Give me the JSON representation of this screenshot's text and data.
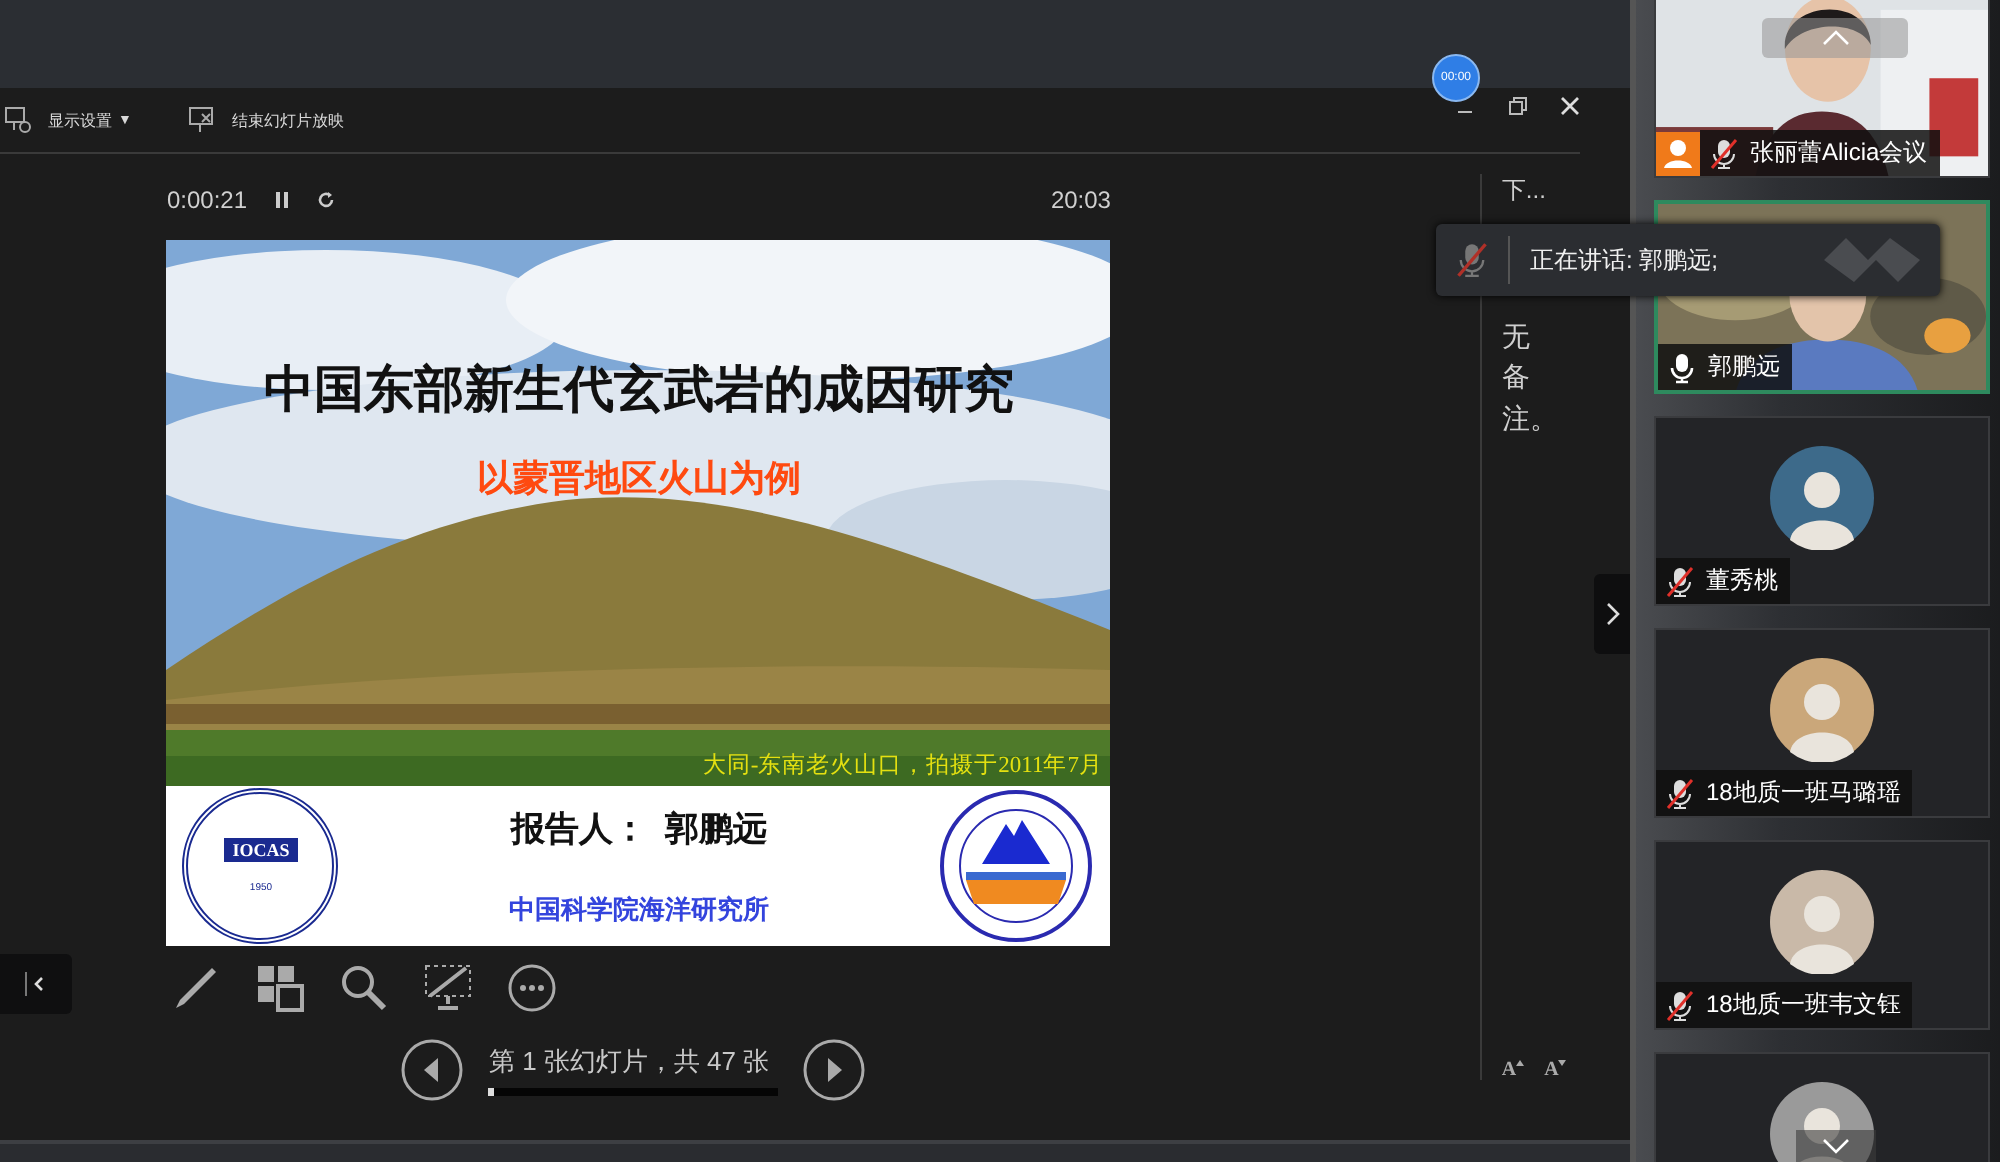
{
  "recording_badge": "00:00",
  "toolbar": [
    {
      "label": "显示设置",
      "caret": "▼",
      "kind": "display"
    },
    {
      "label": "结束幻灯片放映",
      "kind": "end"
    }
  ],
  "timer": {
    "elapsed": "0:00:21",
    "clock": "20:03"
  },
  "slide": {
    "title": "中国东部新生代玄武岩的成因研究",
    "subtitle": "以蒙晋地区火山为例",
    "photo_caption": "大同-东南老火山口，拍摄于2011年7月",
    "presenter": "报告人：  郭鹏远",
    "institute": "中国科学院海洋研究所",
    "logo_text": "IOCAS",
    "logo_year": "1950"
  },
  "navigation": {
    "counter": "第 1 张幻灯片，共 47 张",
    "level": 0.02
  },
  "notes": {
    "next_label": "下...",
    "text": "无备注。"
  },
  "font_size_buttons": [
    {
      "label": "A",
      "kind": "increase"
    },
    {
      "label": "A",
      "kind": "decrease"
    }
  ],
  "speaking_toast": {
    "text": "正在讲话: 郭鹏远;"
  },
  "participants": [
    {
      "name": "张丽蕾Alicia会议",
      "kind": "video",
      "muted": true,
      "host": true,
      "active": false
    },
    {
      "name": "郭鹏远",
      "kind": "video",
      "muted": false,
      "host": false,
      "active": true
    },
    {
      "name": "董秀桃",
      "kind": "avatar",
      "muted": true,
      "host": false,
      "active": false
    },
    {
      "name": "18地质一班马璐瑶",
      "kind": "avatar",
      "muted": true,
      "host": false,
      "active": false
    },
    {
      "name": "18地质一班韦文钰",
      "kind": "avatar",
      "muted": true,
      "host": false,
      "active": false
    },
    {
      "kind": "avatar",
      "host": false,
      "active": false
    }
  ]
}
